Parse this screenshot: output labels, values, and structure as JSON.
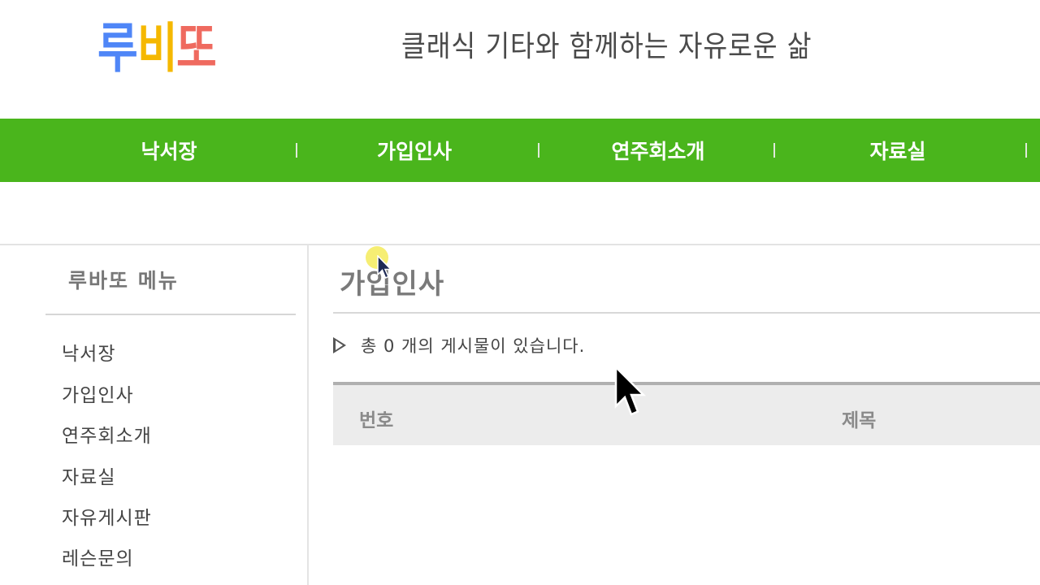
{
  "header": {
    "logo": {
      "chars": [
        {
          "text": "루",
          "color": "#4f86f7"
        },
        {
          "text": "비",
          "color": "#f5b800"
        },
        {
          "text": "또",
          "color": "#ef6a5f"
        }
      ]
    },
    "tagline": "클래식 기타와 함께하는 자유로운 삶"
  },
  "nav": {
    "items": [
      "낙서장",
      "가입인사",
      "연주회소개",
      "자료실"
    ],
    "bg_color": "#4ab51c"
  },
  "sidebar": {
    "title": "루바또 메뉴",
    "items": [
      "낙서장",
      "가입인사",
      "연주회소개",
      "자료실",
      "자유게시판",
      "레슨문의"
    ]
  },
  "main": {
    "title": "가입인사",
    "post_count_text": "총 0 개의 게시물이 있습니다.",
    "table": {
      "headers": [
        "번호",
        "제목"
      ]
    }
  },
  "icons": {
    "post_count_marker": "triangle-right-outline-icon",
    "mouse_cursor": "arrow-cursor-icon"
  }
}
